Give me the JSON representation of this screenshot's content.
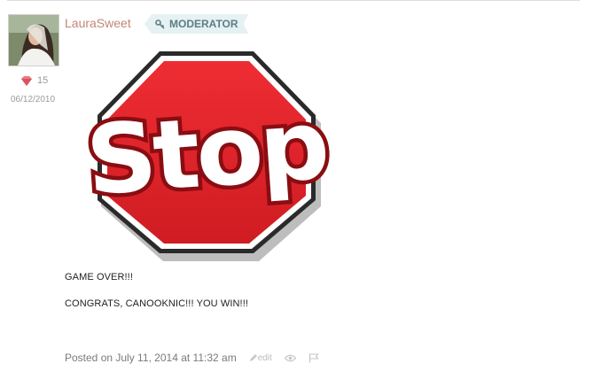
{
  "author": {
    "username": "LauraSweet",
    "badge": "MODERATOR",
    "reputation": "15",
    "join_date": "06/12/2010"
  },
  "image": {
    "stop_text": "Stop"
  },
  "post": {
    "lines": [
      "GAME OVER!!!",
      "CONGRATS, CANOOKNIC!!! YOU WIN!!!"
    ]
  },
  "footer": {
    "posted_on": "Posted on July 11, 2014 at 11:32 am",
    "edit_label": "edit"
  },
  "colors": {
    "stop_red": "#e0242b",
    "username": "#c48672",
    "badge_bg": "#e5f1f3"
  },
  "icons": [
    "key-icon",
    "gem-icon",
    "pencil-icon",
    "eye-icon",
    "flag-icon"
  ]
}
